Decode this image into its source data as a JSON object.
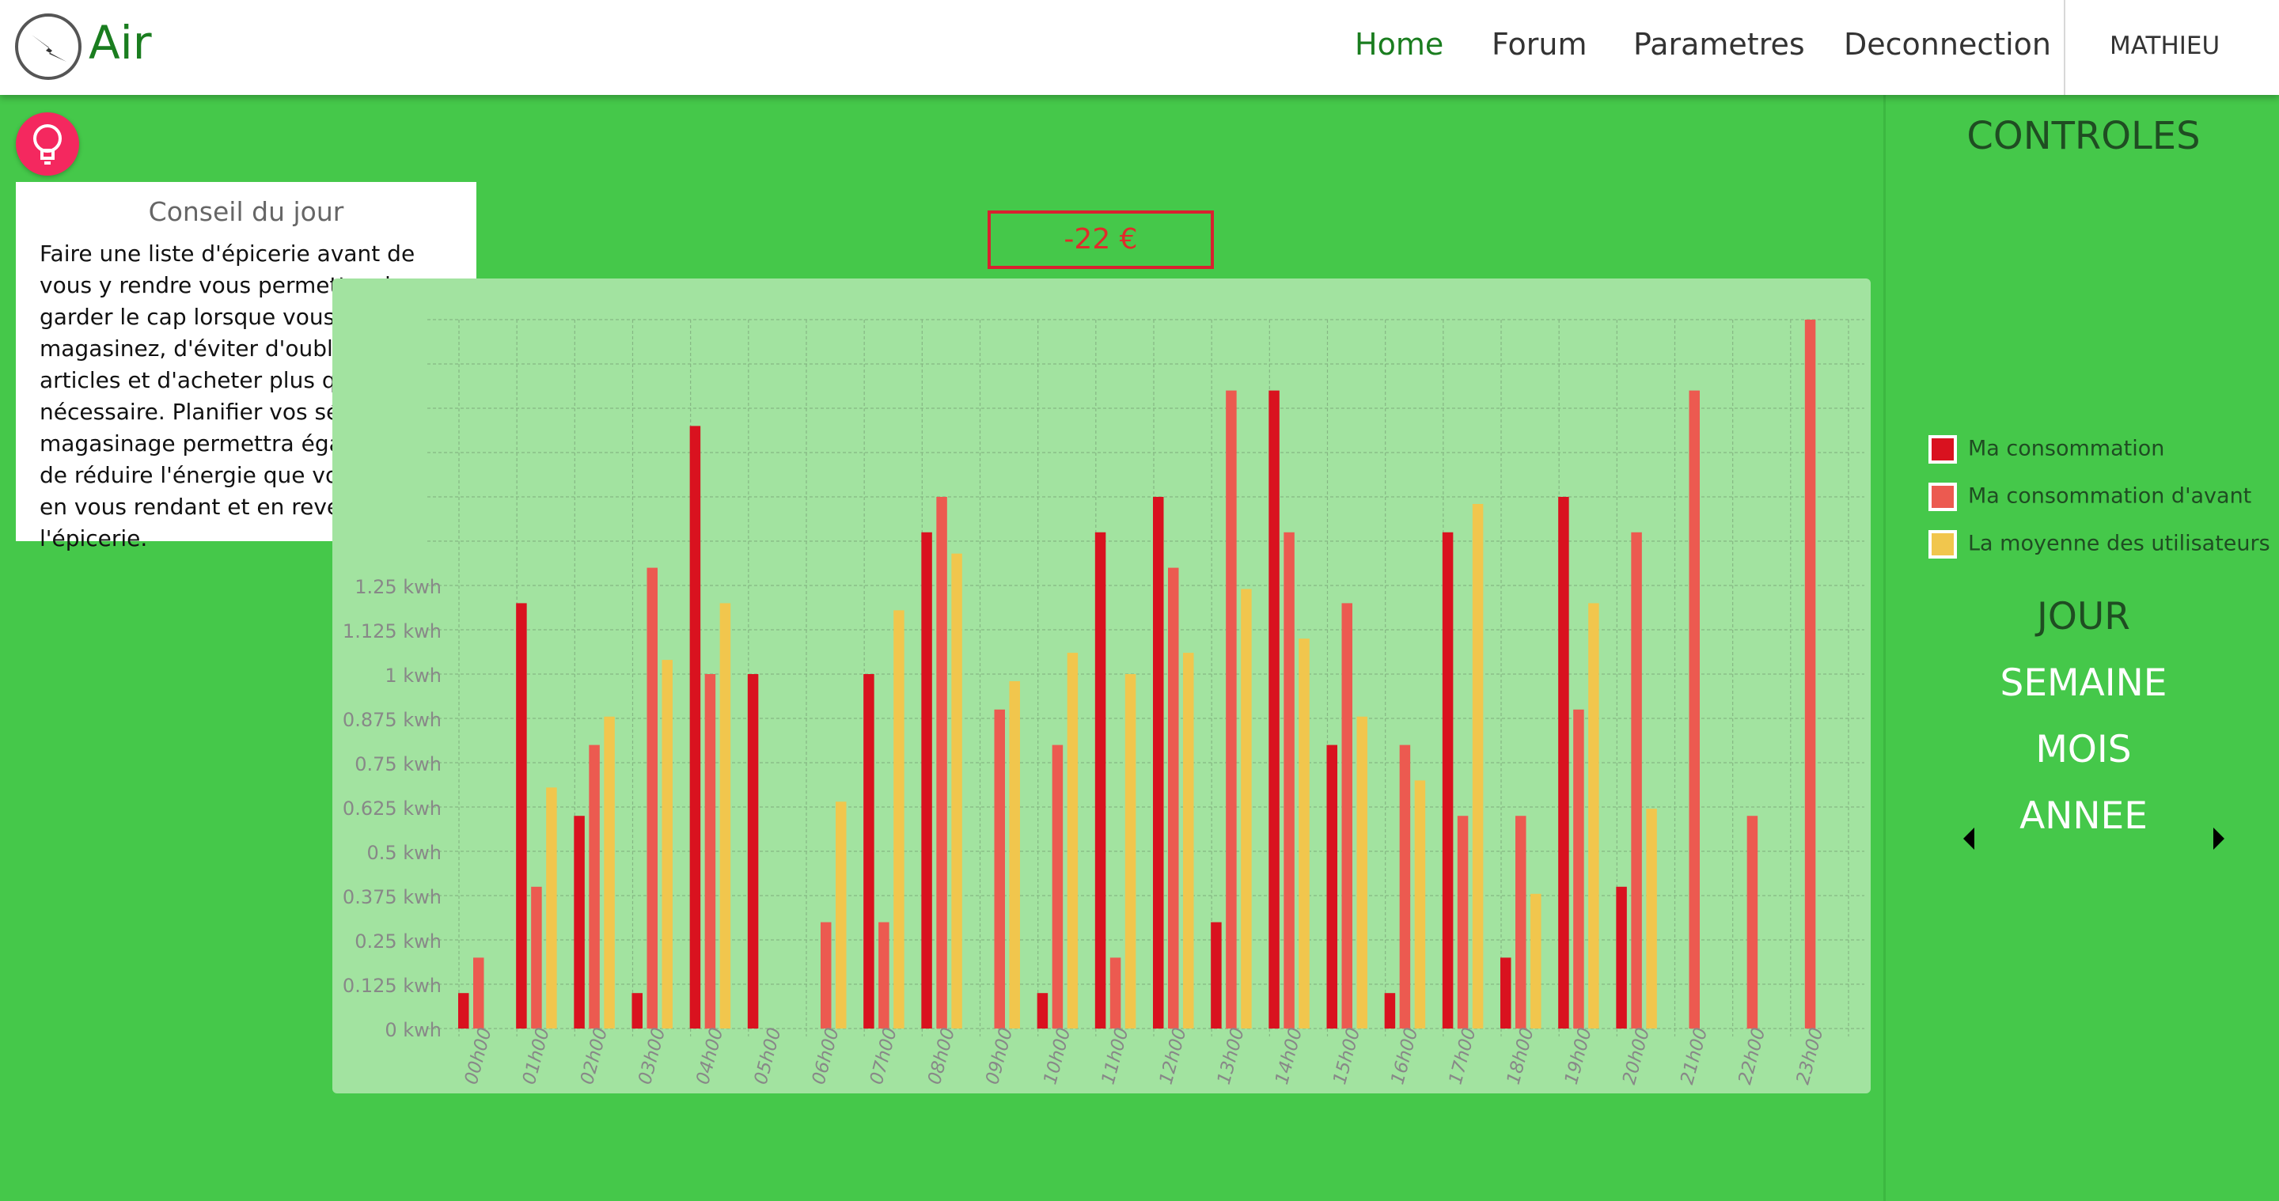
{
  "app": {
    "title": "Air"
  },
  "nav": {
    "items": [
      {
        "label": "Home",
        "active": true
      },
      {
        "label": "Forum"
      },
      {
        "label": "Parametres"
      },
      {
        "label": "Deconnection"
      }
    ],
    "user": "MATHIEU"
  },
  "tip": {
    "title": "Conseil du jour",
    "body": "Faire une liste d'épicerie avant de vous y rendre vous permettra de garder le cap lorsque vous magasinez, d'éviter d'oublier des articles et d'acheter plus que nécessaire. Planifier vos séances de magasinage permettra également de réduire l'énergie que vous utilisez en vous rendant et en revenant de l'épicerie."
  },
  "price": "-22 €",
  "controls": {
    "title": "CONTROLES",
    "legend": [
      {
        "label": "Ma consommation",
        "color": "#d9121f"
      },
      {
        "label": "Ma consommation d'avant",
        "color": "#ec5a50"
      },
      {
        "label": "La moyenne des utilisateurs",
        "color": "#f1c64d"
      }
    ],
    "periods": [
      {
        "label": "JOUR",
        "selected": true
      },
      {
        "label": "SEMAINE"
      },
      {
        "label": "MOIS"
      },
      {
        "label": "ANNEE"
      }
    ]
  },
  "chart_data": {
    "type": "bar",
    "title": "",
    "xlabel": "",
    "ylabel": "",
    "ylim": [
      0,
      2.0
    ],
    "ytick_labels": [
      "0 kwh",
      "0.125 kwh",
      "0.25 kwh",
      "0.375 kwh",
      "0.5 kwh",
      "0.625 kwh",
      "0.75 kwh",
      "0.875 kwh",
      "1 kwh",
      "1.125 kwh",
      "1.25 kwh"
    ],
    "grid": true,
    "categories": [
      "00h00",
      "01h00",
      "02h00",
      "03h00",
      "04h00",
      "05h00",
      "06h00",
      "07h00",
      "08h00",
      "09h00",
      "10h00",
      "11h00",
      "12h00",
      "13h00",
      "14h00",
      "15h00",
      "16h00",
      "17h00",
      "18h00",
      "19h00",
      "20h00",
      "21h00",
      "22h00",
      "23h00"
    ],
    "series": [
      {
        "name": "Ma consommation",
        "color": "#d9121f",
        "values": [
          0.1,
          1.2,
          0.6,
          0.1,
          1.7,
          1.0,
          0,
          1.0,
          1.4,
          0,
          0.1,
          1.4,
          1.5,
          0.3,
          1.8,
          0.8,
          0.1,
          1.4,
          0.2,
          1.5,
          0.4,
          0,
          0,
          0
        ]
      },
      {
        "name": "Ma consommation d'avant",
        "color": "#ec5a50",
        "values": [
          0.2,
          0.4,
          0.8,
          1.3,
          1.0,
          0,
          0.3,
          0.3,
          1.5,
          0.9,
          0.8,
          0.2,
          1.3,
          1.8,
          1.4,
          1.2,
          0.8,
          0.6,
          0.6,
          0.9,
          1.4,
          1.8,
          0.6,
          2.0
        ]
      },
      {
        "name": "La moyenne des utilisateurs",
        "color": "#f1c64d",
        "values": [
          0,
          0.68,
          0.88,
          1.04,
          1.2,
          0,
          0.64,
          1.18,
          1.34,
          0.98,
          1.06,
          1.0,
          1.06,
          1.24,
          1.1,
          0.88,
          0.7,
          1.48,
          0.38,
          1.2,
          0.62,
          0,
          0,
          0
        ]
      }
    ]
  }
}
